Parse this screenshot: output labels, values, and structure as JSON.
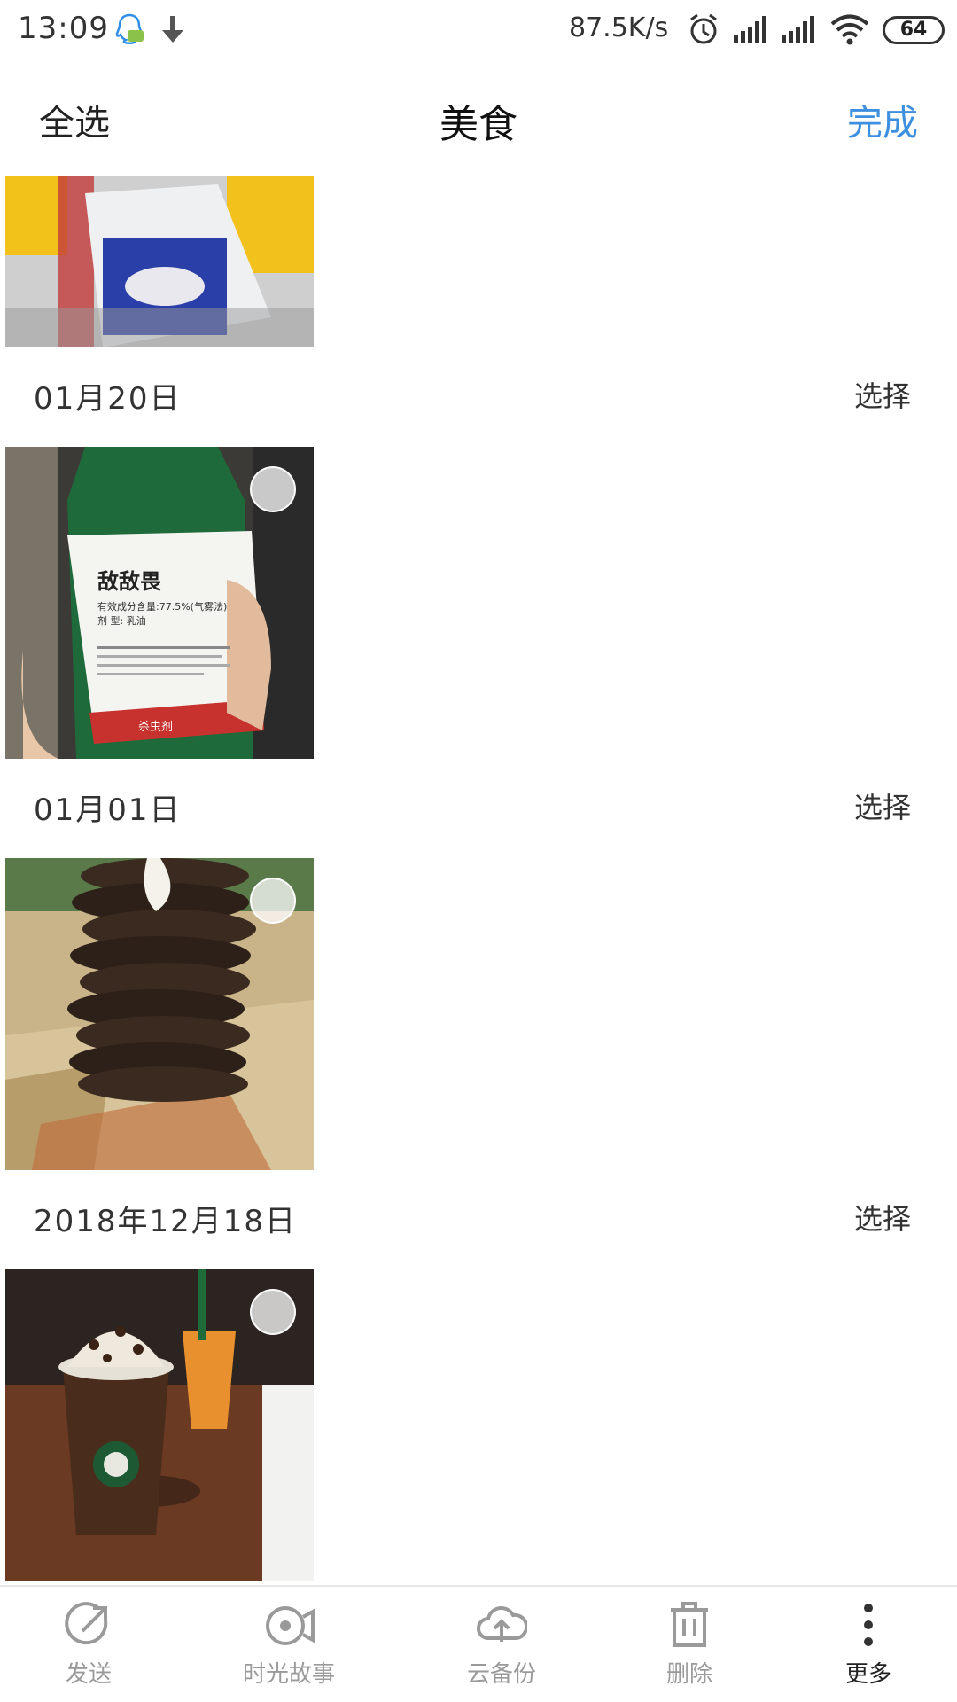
{
  "status_bar": {
    "time": "13:09",
    "speed": "87.5K/s",
    "battery": "64"
  },
  "header": {
    "select_all": "全选",
    "title": "美食",
    "done": "完成",
    "accent_color": "#3d8fe0"
  },
  "groups": [
    {
      "date": "01月20日",
      "select_label": "选择",
      "photo_icon": "pesticide-bottle-photo"
    },
    {
      "date": "01月01日",
      "select_label": "选择",
      "photo_icon": "burnt-cookie-stack-photo"
    },
    {
      "date": "2018年12月18日",
      "select_label": "选择",
      "photo_icon": "starbucks-drinks-photo"
    }
  ],
  "photo_text": {
    "bottle_title": "敌敌畏",
    "bottle_line1": "有效成分含量:77.5%(气雾法)",
    "bottle_line2": "剂 型: 乳油",
    "bottle_footer": "杀虫剂"
  },
  "toolbar": {
    "items": [
      {
        "label": "发送",
        "icon": "share-icon"
      },
      {
        "label": "时光故事",
        "icon": "video-story-icon"
      },
      {
        "label": "云备份",
        "icon": "cloud-upload-icon"
      },
      {
        "label": "删除",
        "icon": "trash-icon"
      },
      {
        "label": "更多",
        "icon": "more-vertical-icon"
      }
    ]
  }
}
